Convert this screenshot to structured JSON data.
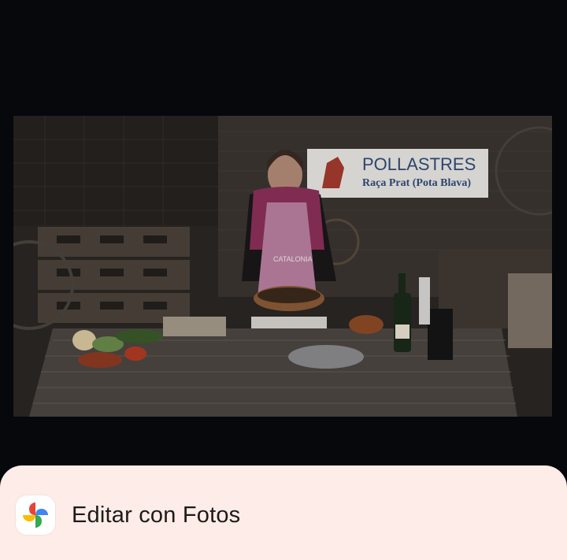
{
  "video": {
    "banner_title": "POLLASTRES",
    "banner_subtitle": "Raça Prat (Pota Blava)",
    "apron_text": "CATALONIA"
  },
  "share_sheet": {
    "app_label": "Editar con Fotos",
    "app_icon": "google-photos-pinwheel-icon"
  },
  "colors": {
    "background": "#06080b",
    "sheet_background": "#fdece7",
    "photos_red": "#ea4335",
    "photos_yellow": "#fbbc04",
    "photos_green": "#34a853",
    "photos_blue": "#4285f4"
  }
}
